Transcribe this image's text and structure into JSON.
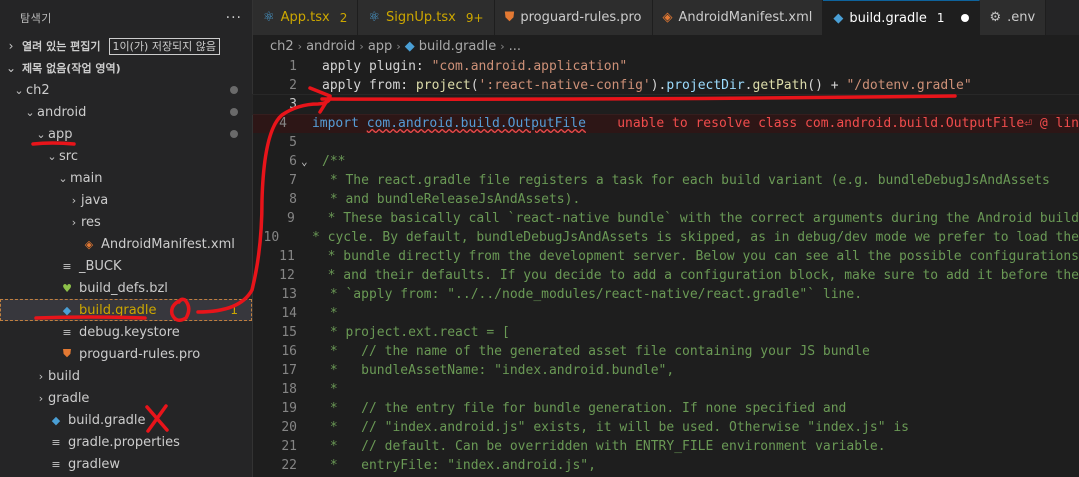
{
  "explorer": {
    "title": "탐색기",
    "more": "···",
    "open_editors_label": "열려 있는 편집기",
    "unsaved_badge": "1이(가) 저장되지 않음",
    "workspace_label": "제목 없음(작업 영역)"
  },
  "tree": [
    {
      "label": "ch2",
      "depth": 0,
      "chevron": "⌄",
      "icon": "",
      "dot": true
    },
    {
      "label": "android",
      "depth": 1,
      "chevron": "⌄",
      "icon": "",
      "dot": true
    },
    {
      "label": "app",
      "depth": 2,
      "chevron": "⌄",
      "icon": "",
      "dot": true
    },
    {
      "label": "src",
      "depth": 3,
      "chevron": "⌄",
      "icon": ""
    },
    {
      "label": "main",
      "depth": 4,
      "chevron": "⌄",
      "icon": ""
    },
    {
      "label": "java",
      "depth": 5,
      "chevron": "›",
      "icon": ""
    },
    {
      "label": "res",
      "depth": 5,
      "chevron": "›",
      "icon": ""
    },
    {
      "label": "AndroidManifest.xml",
      "depth": 5,
      "chevron": "",
      "icon": "xml-icon"
    },
    {
      "label": "_BUCK",
      "depth": 3,
      "chevron": "",
      "icon": "file-icon"
    },
    {
      "label": "build_defs.bzl",
      "depth": 3,
      "chevron": "",
      "icon": "heart-icon"
    },
    {
      "label": "build.gradle",
      "depth": 3,
      "chevron": "",
      "icon": "gradle-icon",
      "count": "1",
      "selected": true
    },
    {
      "label": "debug.keystore",
      "depth": 3,
      "chevron": "",
      "icon": "key-file-icon"
    },
    {
      "label": "proguard-rules.pro",
      "depth": 3,
      "chevron": "",
      "icon": "shield-icon"
    },
    {
      "label": "build",
      "depth": 2,
      "chevron": "›",
      "icon": ""
    },
    {
      "label": "gradle",
      "depth": 2,
      "chevron": "›",
      "icon": ""
    },
    {
      "label": "build.gradle",
      "depth": 2,
      "chevron": "",
      "icon": "gradle-icon"
    },
    {
      "label": "gradle.properties",
      "depth": 2,
      "chevron": "",
      "icon": "file-icon"
    },
    {
      "label": "gradlew",
      "depth": 2,
      "chevron": "",
      "icon": "file-icon"
    }
  ],
  "tabs": [
    {
      "label": "App.tsx",
      "badge": "2",
      "icon": "settings-icon",
      "style": "warn"
    },
    {
      "label": "SignUp.tsx",
      "badge": "9+",
      "icon": "settings-icon",
      "style": "warn"
    },
    {
      "label": "proguard-rules.pro",
      "badge": "",
      "icon": "shield-icon",
      "style": ""
    },
    {
      "label": "AndroidManifest.xml",
      "badge": "",
      "icon": "xml-icon",
      "style": ""
    },
    {
      "label": "build.gradle",
      "badge": "1",
      "icon": "gradle-icon",
      "style": "active"
    },
    {
      "label": ".env",
      "badge": "",
      "icon": "gear-icon",
      "style": ""
    }
  ],
  "breadcrumb": [
    "ch2",
    "android",
    "app",
    "build.gradle",
    "..."
  ],
  "code_lines": [
    {
      "n": "1",
      "tokens": [
        [
          "apply plugin: ",
          "plain"
        ],
        [
          "\"com.android.application\"",
          "str"
        ]
      ]
    },
    {
      "n": "2",
      "tokens": [
        [
          "apply from: ",
          "plain"
        ],
        [
          "project",
          "fn"
        ],
        [
          "(",
          "plain"
        ],
        [
          "':react-native-config'",
          "str"
        ],
        [
          ").",
          "plain"
        ],
        [
          "projectDir",
          "var"
        ],
        [
          ".",
          "plain"
        ],
        [
          "getPath",
          "fn"
        ],
        [
          "() + ",
          "plain"
        ],
        [
          "\"/dotenv.gradle\"",
          "str"
        ]
      ]
    },
    {
      "n": "3",
      "tokens": [
        [
          "",
          "plain"
        ]
      ],
      "current": true
    },
    {
      "n": "4",
      "tokens": [
        [
          "import ",
          "kw"
        ],
        [
          "com.android.build.OutputFile",
          "imp"
        ],
        [
          "    unable to resolve class com.android.build.OutputFile⏎ @ lin",
          "err"
        ]
      ],
      "error": true
    },
    {
      "n": "5",
      "tokens": [
        [
          "",
          "plain"
        ]
      ]
    },
    {
      "n": "6",
      "tokens": [
        [
          "/**",
          "cm"
        ]
      ],
      "fold": true
    },
    {
      "n": "7",
      "tokens": [
        [
          " * The react.gradle file registers a task for each build variant (e.g. bundleDebugJsAndAssets",
          "cm"
        ]
      ]
    },
    {
      "n": "8",
      "tokens": [
        [
          " * and bundleReleaseJsAndAssets).",
          "cm"
        ]
      ]
    },
    {
      "n": "9",
      "tokens": [
        [
          " * These basically call `react-native bundle` with the correct arguments during the Android build",
          "cm"
        ]
      ]
    },
    {
      "n": "10",
      "tokens": [
        [
          " * cycle. By default, bundleDebugJsAndAssets is skipped, as in debug/dev mode we prefer to load the",
          "cm"
        ]
      ]
    },
    {
      "n": "11",
      "tokens": [
        [
          " * bundle directly from the development server. Below you can see all the possible configurations",
          "cm"
        ]
      ]
    },
    {
      "n": "12",
      "tokens": [
        [
          " * and their defaults. If you decide to add a configuration block, make sure to add it before the",
          "cm"
        ]
      ]
    },
    {
      "n": "13",
      "tokens": [
        [
          " * `apply from: \"../../node_modules/react-native/react.gradle\"` line.",
          "cm"
        ]
      ]
    },
    {
      "n": "14",
      "tokens": [
        [
          " *",
          "cm"
        ]
      ]
    },
    {
      "n": "15",
      "tokens": [
        [
          " * project.ext.react = [",
          "cm"
        ]
      ]
    },
    {
      "n": "16",
      "tokens": [
        [
          " *   // the name of the generated asset file containing your JS bundle",
          "cm"
        ]
      ]
    },
    {
      "n": "17",
      "tokens": [
        [
          " *   bundleAssetName: \"index.android.bundle\",",
          "cm"
        ]
      ]
    },
    {
      "n": "18",
      "tokens": [
        [
          " *",
          "cm"
        ]
      ]
    },
    {
      "n": "19",
      "tokens": [
        [
          " *   // the entry file for bundle generation. If none specified and",
          "cm"
        ]
      ]
    },
    {
      "n": "20",
      "tokens": [
        [
          " *   // \"index.android.js\" exists, it will be used. Otherwise \"index.js\" is",
          "cm"
        ]
      ]
    },
    {
      "n": "21",
      "tokens": [
        [
          " *   // default. Can be overridden with ENTRY_FILE environment variable.",
          "cm"
        ]
      ]
    },
    {
      "n": "22",
      "tokens": [
        [
          " *   entryFile: \"index.android.js\",",
          "cm"
        ]
      ]
    }
  ],
  "colors": {
    "accent": "#0e639c",
    "annotation_red": "#e8141a",
    "warning": "#cca700"
  }
}
